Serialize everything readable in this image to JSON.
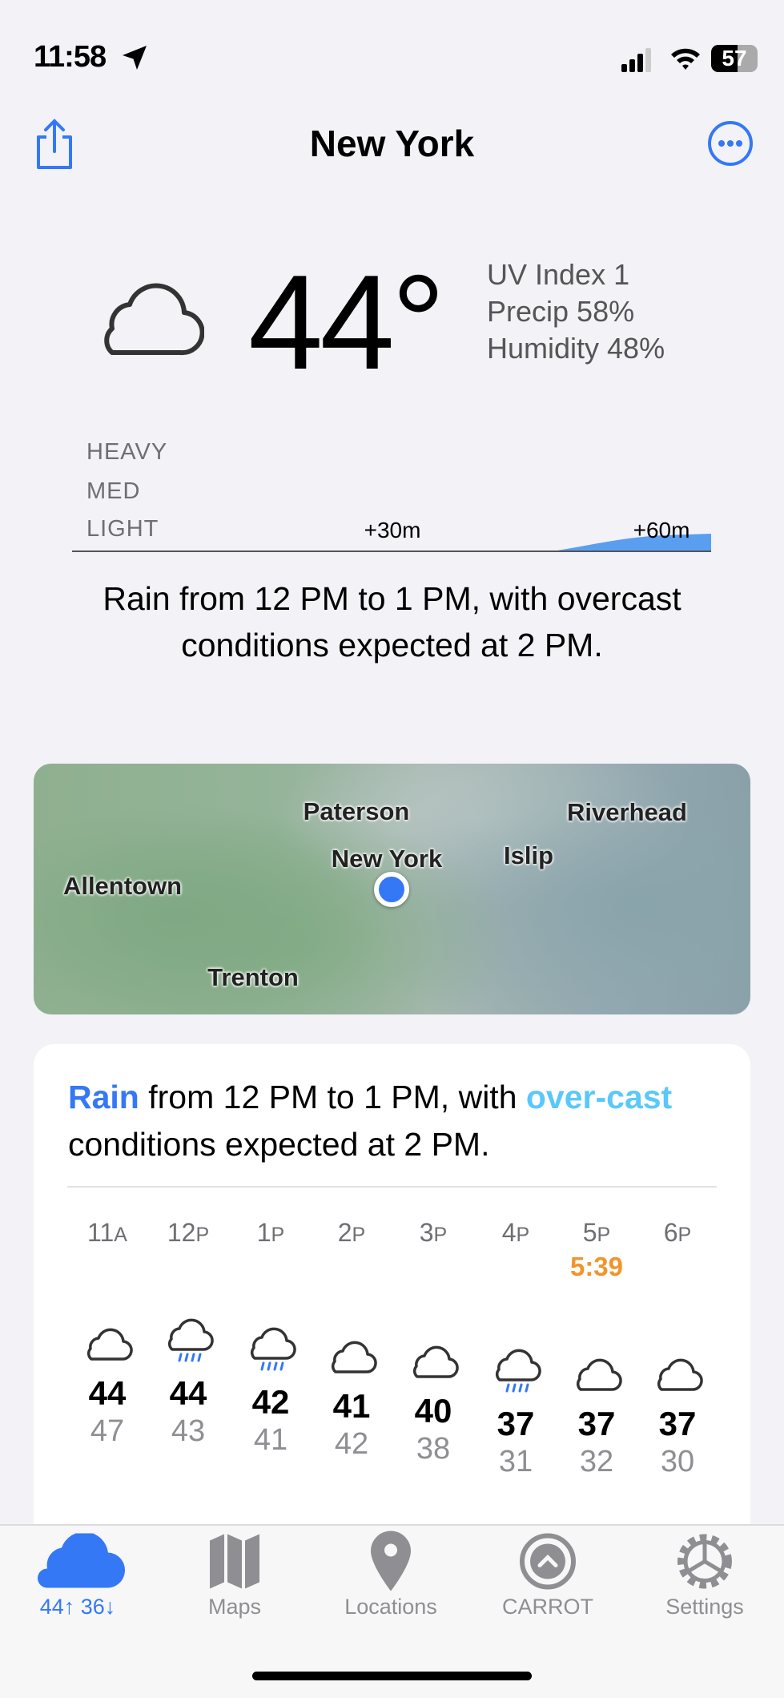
{
  "status_bar": {
    "time": "11:58",
    "battery": "57"
  },
  "nav": {
    "title": "New York",
    "share_icon": "share-icon",
    "more_icon": "ellipsis-circle-icon"
  },
  "current": {
    "icon": "cloud-icon",
    "temperature": "44°",
    "uv": "UV Index 1",
    "precip": "Precip 58%",
    "humidity": "Humidity 48%"
  },
  "precip_chart": {
    "levels": [
      "HEAVY",
      "MED",
      "LIGHT"
    ],
    "ticks": [
      "+30m",
      "+60m"
    ],
    "color": "#5a9ef0"
  },
  "summary": "Rain from 12 PM to 1 PM, with overcast conditions expected at 2 PM.",
  "map": {
    "labels": [
      "Paterson",
      "New York",
      "Islip",
      "Riverhead",
      "Allentown",
      "Trenton"
    ]
  },
  "forecast_card": {
    "rain_word": "Rain",
    "mid_text": " from 12 PM to 1 PM, with ",
    "overcast_word": "over-cast",
    "end_text": " conditions expected at 2 PM.",
    "accent": "#3478f6",
    "accent2": "#5ac8fa"
  },
  "hourly": [
    {
      "hour": "11",
      "ampm": "A",
      "icon": "cloud",
      "temp": 44,
      "feels": 47
    },
    {
      "hour": "12",
      "ampm": "P",
      "icon": "rain",
      "temp": 44,
      "feels": 43
    },
    {
      "hour": "1",
      "ampm": "P",
      "icon": "rain",
      "temp": 42,
      "feels": 41
    },
    {
      "hour": "2",
      "ampm": "P",
      "icon": "cloud",
      "temp": 41,
      "feels": 42
    },
    {
      "hour": "3",
      "ampm": "P",
      "icon": "cloud",
      "temp": 40,
      "feels": 38
    },
    {
      "hour": "4",
      "ampm": "P",
      "icon": "rain",
      "temp": 37,
      "feels": 31
    },
    {
      "hour": "5",
      "ampm": "P",
      "icon": "cloud",
      "temp": 37,
      "feels": 32,
      "sunset": "5:39"
    },
    {
      "hour": "6",
      "ampm": "P",
      "icon": "cloud",
      "temp": 37,
      "feels": 30
    }
  ],
  "tabs": [
    {
      "label": "44↑ 36↓",
      "icon": "cloud-fill-icon",
      "active": true
    },
    {
      "label": "Maps",
      "icon": "map-icon"
    },
    {
      "label": "Locations",
      "icon": "location-pin-icon"
    },
    {
      "label": "CARROT",
      "icon": "carrot-logo-icon"
    },
    {
      "label": "Settings",
      "icon": "gear-icon"
    }
  ]
}
